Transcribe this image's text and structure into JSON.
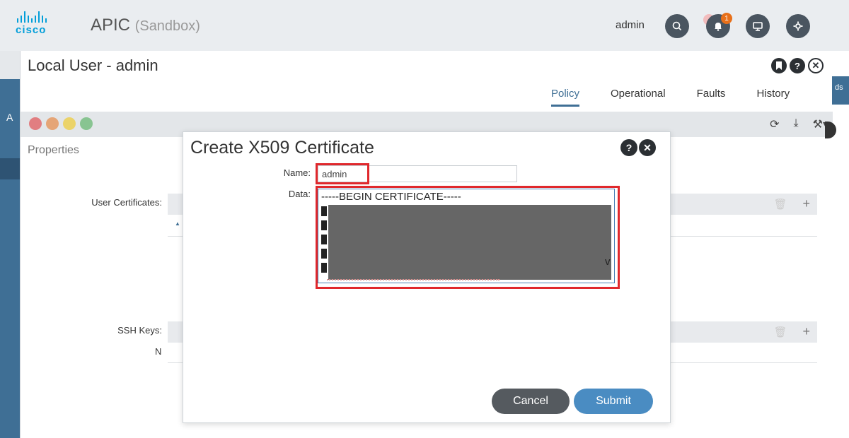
{
  "header": {
    "brand": "cisco",
    "app_name": "APIC",
    "environment": "(Sandbox)",
    "user": "admin",
    "notification_count": "1",
    "icons": [
      "search-icon",
      "bell-icon",
      "display-icon",
      "gear-icon"
    ]
  },
  "background": {
    "left_letter": "A",
    "right_edge_text": "ds"
  },
  "panel": {
    "title": "Local User - admin",
    "tabs": [
      {
        "label": "Policy",
        "active": true
      },
      {
        "label": "Operational",
        "active": false
      },
      {
        "label": "Faults",
        "active": false
      },
      {
        "label": "History",
        "active": false
      }
    ],
    "properties_label": "Properties",
    "user_certificates_label": "User Certificates:",
    "ssh_keys_label": "SSH Keys:",
    "ssh_keys_column_partial": "N",
    "fault_colors": [
      "#e0282c",
      "#e8701a",
      "#f2c200",
      "#3ea849"
    ]
  },
  "modal": {
    "title": "Create X509 Certificate",
    "name_label": "Name:",
    "name_value": "admin",
    "data_label": "Data:",
    "data_first_line": "-----BEGIN CERTIFICATE-----",
    "data_tail_char": "v",
    "cancel_label": "Cancel",
    "submit_label": "Submit"
  },
  "colors": {
    "accent_blue": "#3f6f95",
    "submit_blue": "#4a8cc2",
    "highlight_red": "#e0282c",
    "brand_cyan": "#049fd9"
  }
}
